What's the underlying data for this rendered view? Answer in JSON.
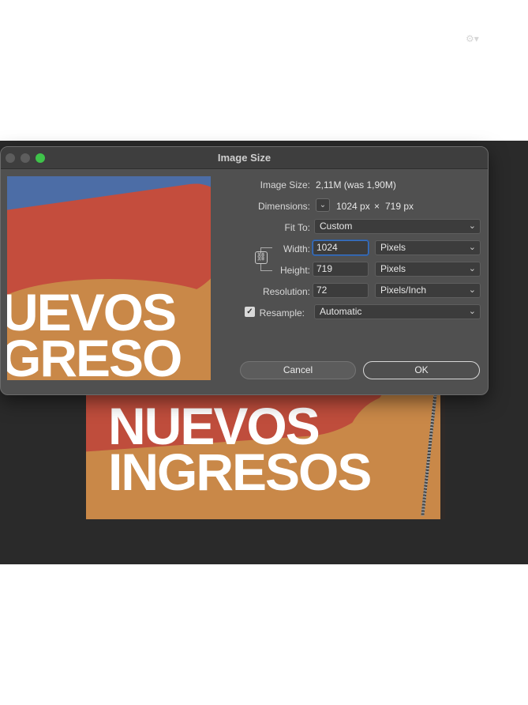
{
  "window": {
    "title": "Image Size"
  },
  "image_text": {
    "line1": "NUEVOS",
    "line2": "INGRESOS"
  },
  "preview_text": {
    "line1": "UEVOS",
    "line2": "GRESO"
  },
  "image_size": {
    "label": "Image Size:",
    "value": "2,11M (was 1,90M)"
  },
  "dimensions": {
    "label": "Dimensions:",
    "width": "1024 px",
    "times": "×",
    "height": "719 px"
  },
  "fit_to": {
    "label": "Fit To:",
    "value": "Custom"
  },
  "width": {
    "label": "Width:",
    "value": "1024",
    "unit": "Pixels"
  },
  "height": {
    "label": "Height:",
    "value": "719",
    "unit": "Pixels"
  },
  "resolution": {
    "label": "Resolution:",
    "value": "72",
    "unit": "Pixels/Inch"
  },
  "resample": {
    "label": "Resample:",
    "checked": true,
    "value": "Automatic"
  },
  "buttons": {
    "cancel": "Cancel",
    "ok": "OK"
  },
  "icons": [
    "gear-icon",
    "chevron-down-icon",
    "link-icon",
    "checkmark-icon"
  ],
  "colors": {
    "ok_border": "#d8d8d8",
    "focus_border": "#3b73c4",
    "zoom_button": "#3fc34a"
  }
}
